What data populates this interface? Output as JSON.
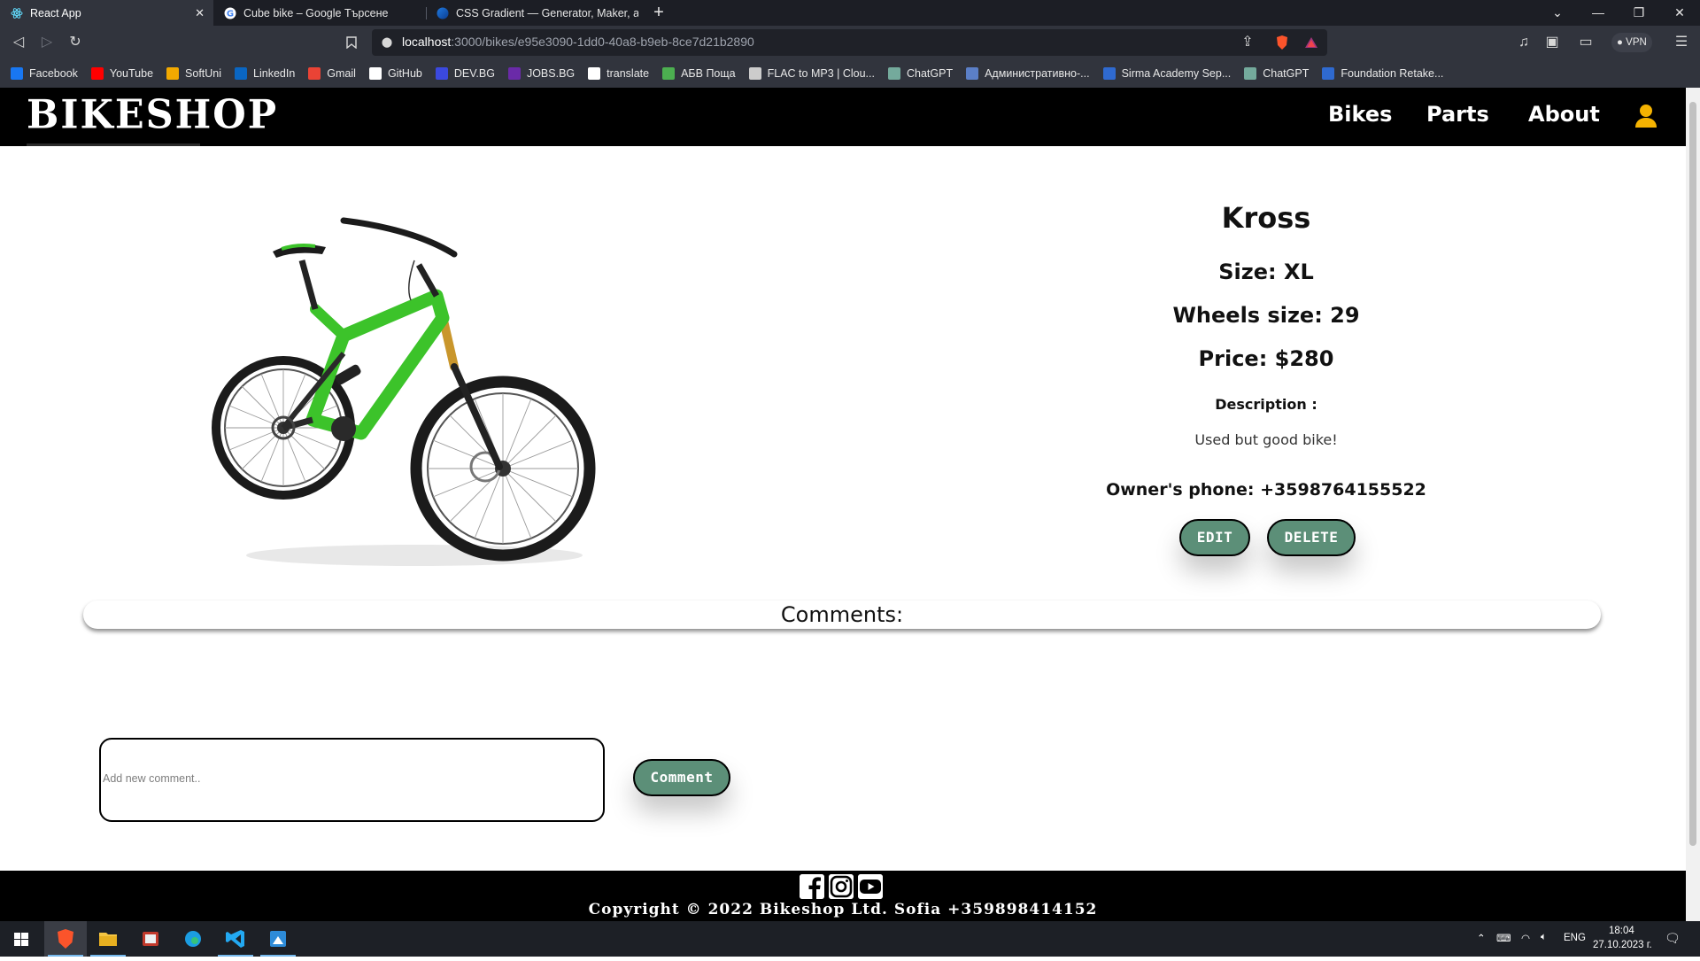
{
  "browser": {
    "tabs": [
      {
        "title": "React App",
        "active": true
      },
      {
        "title": "Cube bike – Google Търсене",
        "active": false
      },
      {
        "title": "CSS Gradient — Generator, Maker, an",
        "active": false
      }
    ],
    "url_host": "localhost",
    "url_path": ":3000/bikes/e95e3090-1dd0-40a8-b9eb-8ce7d21b2890",
    "vpn_label": "VPN",
    "bookmarks": [
      {
        "label": "Facebook",
        "color": "#1877f2"
      },
      {
        "label": "YouTube",
        "color": "#ff0000"
      },
      {
        "label": "SoftUni",
        "color": "#f2a900"
      },
      {
        "label": "LinkedIn",
        "color": "#0a66c2"
      },
      {
        "label": "Gmail",
        "color": "#ea4335"
      },
      {
        "label": "GitHub",
        "color": "#ffffff"
      },
      {
        "label": "DEV.BG",
        "color": "#3b49df"
      },
      {
        "label": "JOBS.BG",
        "color": "#6a2aa8"
      },
      {
        "label": "translate",
        "color": "#ffffff"
      },
      {
        "label": "АБВ Поща",
        "color": "#4caf50"
      },
      {
        "label": "FLAC to MP3 | Clou...",
        "color": "#cccccc"
      },
      {
        "label": "ChatGPT",
        "color": "#74aa9c"
      },
      {
        "label": "Административно-...",
        "color": "#5b7fc7"
      },
      {
        "label": "Sirma Academy Sep...",
        "color": "#2f6ad0"
      },
      {
        "label": "ChatGPT",
        "color": "#74aa9c"
      },
      {
        "label": "Foundation Retake...",
        "color": "#2f6ad0"
      }
    ]
  },
  "site": {
    "logo": "BIKESHOP",
    "nav": {
      "bikes": "Bikes",
      "parts": "Parts",
      "about": "About"
    }
  },
  "bike": {
    "name": "Kross",
    "size": "Size: XL",
    "wheels": "Wheels size: 29",
    "price": "Price: $280",
    "description_label": "Description :",
    "description": "Used but good bike!",
    "owner_phone": "Owner's phone: +3598764155522",
    "edit_label": "EDIT",
    "delete_label": "DELETE"
  },
  "comments": {
    "title": "Comments:",
    "placeholder": "Add new comment..",
    "button_label": "Comment"
  },
  "footer": {
    "copyright": "Copyright © 2022 Bikeshop Ltd. Sofia +359898414152"
  },
  "taskbar": {
    "lang": "ENG",
    "time": "18:04",
    "date": "27.10.2023 г."
  },
  "colors": {
    "accent_button": "#5c8f78",
    "user_icon": "#f5b301",
    "header_bg": "#000000"
  }
}
